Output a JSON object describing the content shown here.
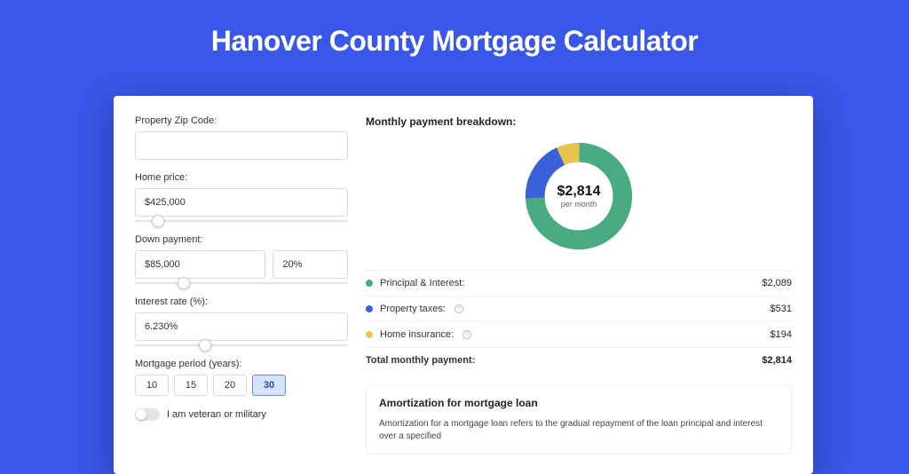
{
  "page_title": "Hanover County Mortgage Calculator",
  "form": {
    "zip_label": "Property Zip Code:",
    "zip_value": "",
    "home_price_label": "Home price:",
    "home_price_value": "$425,000",
    "home_price_slider_pct": 8,
    "down_payment_label": "Down payment:",
    "down_payment_value": "$85,000",
    "down_payment_pct": "20%",
    "down_payment_slider_pct": 20,
    "interest_label": "Interest rate (%):",
    "interest_value": "6.230%",
    "interest_slider_pct": 30,
    "period_label": "Mortgage period (years):",
    "periods": [
      "10",
      "15",
      "20",
      "30"
    ],
    "period_selected": "30",
    "veteran_label": "I am veteran or military",
    "veteran_on": false
  },
  "breakdown": {
    "title": "Monthly payment breakdown:",
    "center_amount": "$2,814",
    "center_sub": "per month",
    "items": [
      {
        "label": "Principal & Interest:",
        "value": "$2,089",
        "color": "green",
        "info": false
      },
      {
        "label": "Property taxes:",
        "value": "$531",
        "color": "blue",
        "info": true
      },
      {
        "label": "Home insurance:",
        "value": "$194",
        "color": "yellow",
        "info": true
      }
    ],
    "total_label": "Total monthly payment:",
    "total_value": "$2,814"
  },
  "amort": {
    "title": "Amortization for mortgage loan",
    "text": "Amortization for a mortgage loan refers to the gradual repayment of the loan principal and interest over a specified"
  },
  "chart_data": {
    "type": "pie",
    "title": "Monthly payment breakdown",
    "series": [
      {
        "name": "Principal & Interest",
        "value": 2089,
        "color": "#4aab82"
      },
      {
        "name": "Property taxes",
        "value": 531,
        "color": "#3a62d8"
      },
      {
        "name": "Home insurance",
        "value": 194,
        "color": "#e8c34d"
      }
    ],
    "total": 2814,
    "unit": "USD per month"
  }
}
